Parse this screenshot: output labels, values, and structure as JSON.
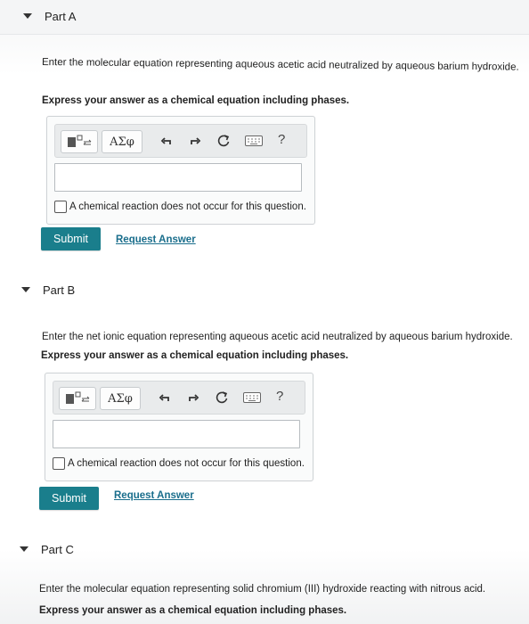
{
  "partA": {
    "title": "Part A",
    "question": "Enter the molecular equation representing aqueous acetic acid neutralized by aqueous barium hydroxide.",
    "instruction": "Express your answer as a chemical equation including phases.",
    "toolbar": {
      "greek_label": "ΑΣφ",
      "help_label": "?"
    },
    "answer_value": "",
    "no_reaction_label": "A chemical reaction does not occur for this question.",
    "submit_label": "Submit",
    "request_label": "Request Answer"
  },
  "partB": {
    "title": "Part B",
    "question": "Enter the net ionic equation representing aqueous acetic acid neutralized by aqueous barium hydroxide.",
    "instruction": "Express your answer as a chemical equation including phases.",
    "toolbar": {
      "greek_label": "ΑΣφ",
      "help_label": "?"
    },
    "answer_value": "",
    "no_reaction_label": "A chemical reaction does not occur for this question.",
    "submit_label": "Submit",
    "request_label": "Request Answer"
  },
  "partC": {
    "title": "Part C",
    "question": "Enter the molecular equation representing solid chromium (III) hydroxide reacting with nitrous acid.",
    "instruction": "Express your answer as a chemical equation including phases."
  },
  "colors": {
    "submit_bg": "#1a7e8c",
    "link": "#1a6e8c"
  }
}
